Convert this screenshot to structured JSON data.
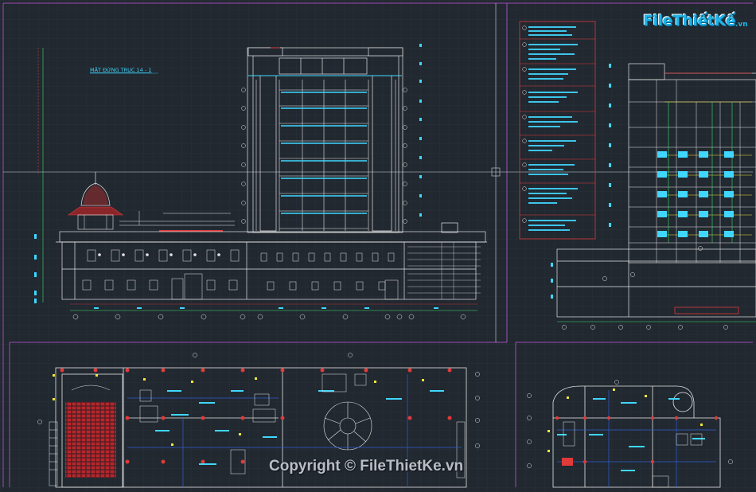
{
  "drawing": {
    "elevation_title": "MẶT ĐỨNG TRỤC 14 - 1"
  },
  "watermark": {
    "logo_text": "FileThiếtKế",
    "logo_domain": ".vn",
    "copyright": "Copyright © FileThietKe.vn"
  },
  "colors": {
    "background": "#212830",
    "line_white": "#e6e6e6",
    "cyan": "#3fd7ff",
    "red": "#e03a3a",
    "yellow": "#f3e63a",
    "green": "#3fe06a",
    "magenta": "#b040c0",
    "grid": "#3c4a58"
  },
  "icons": [
    "logo-icon"
  ]
}
